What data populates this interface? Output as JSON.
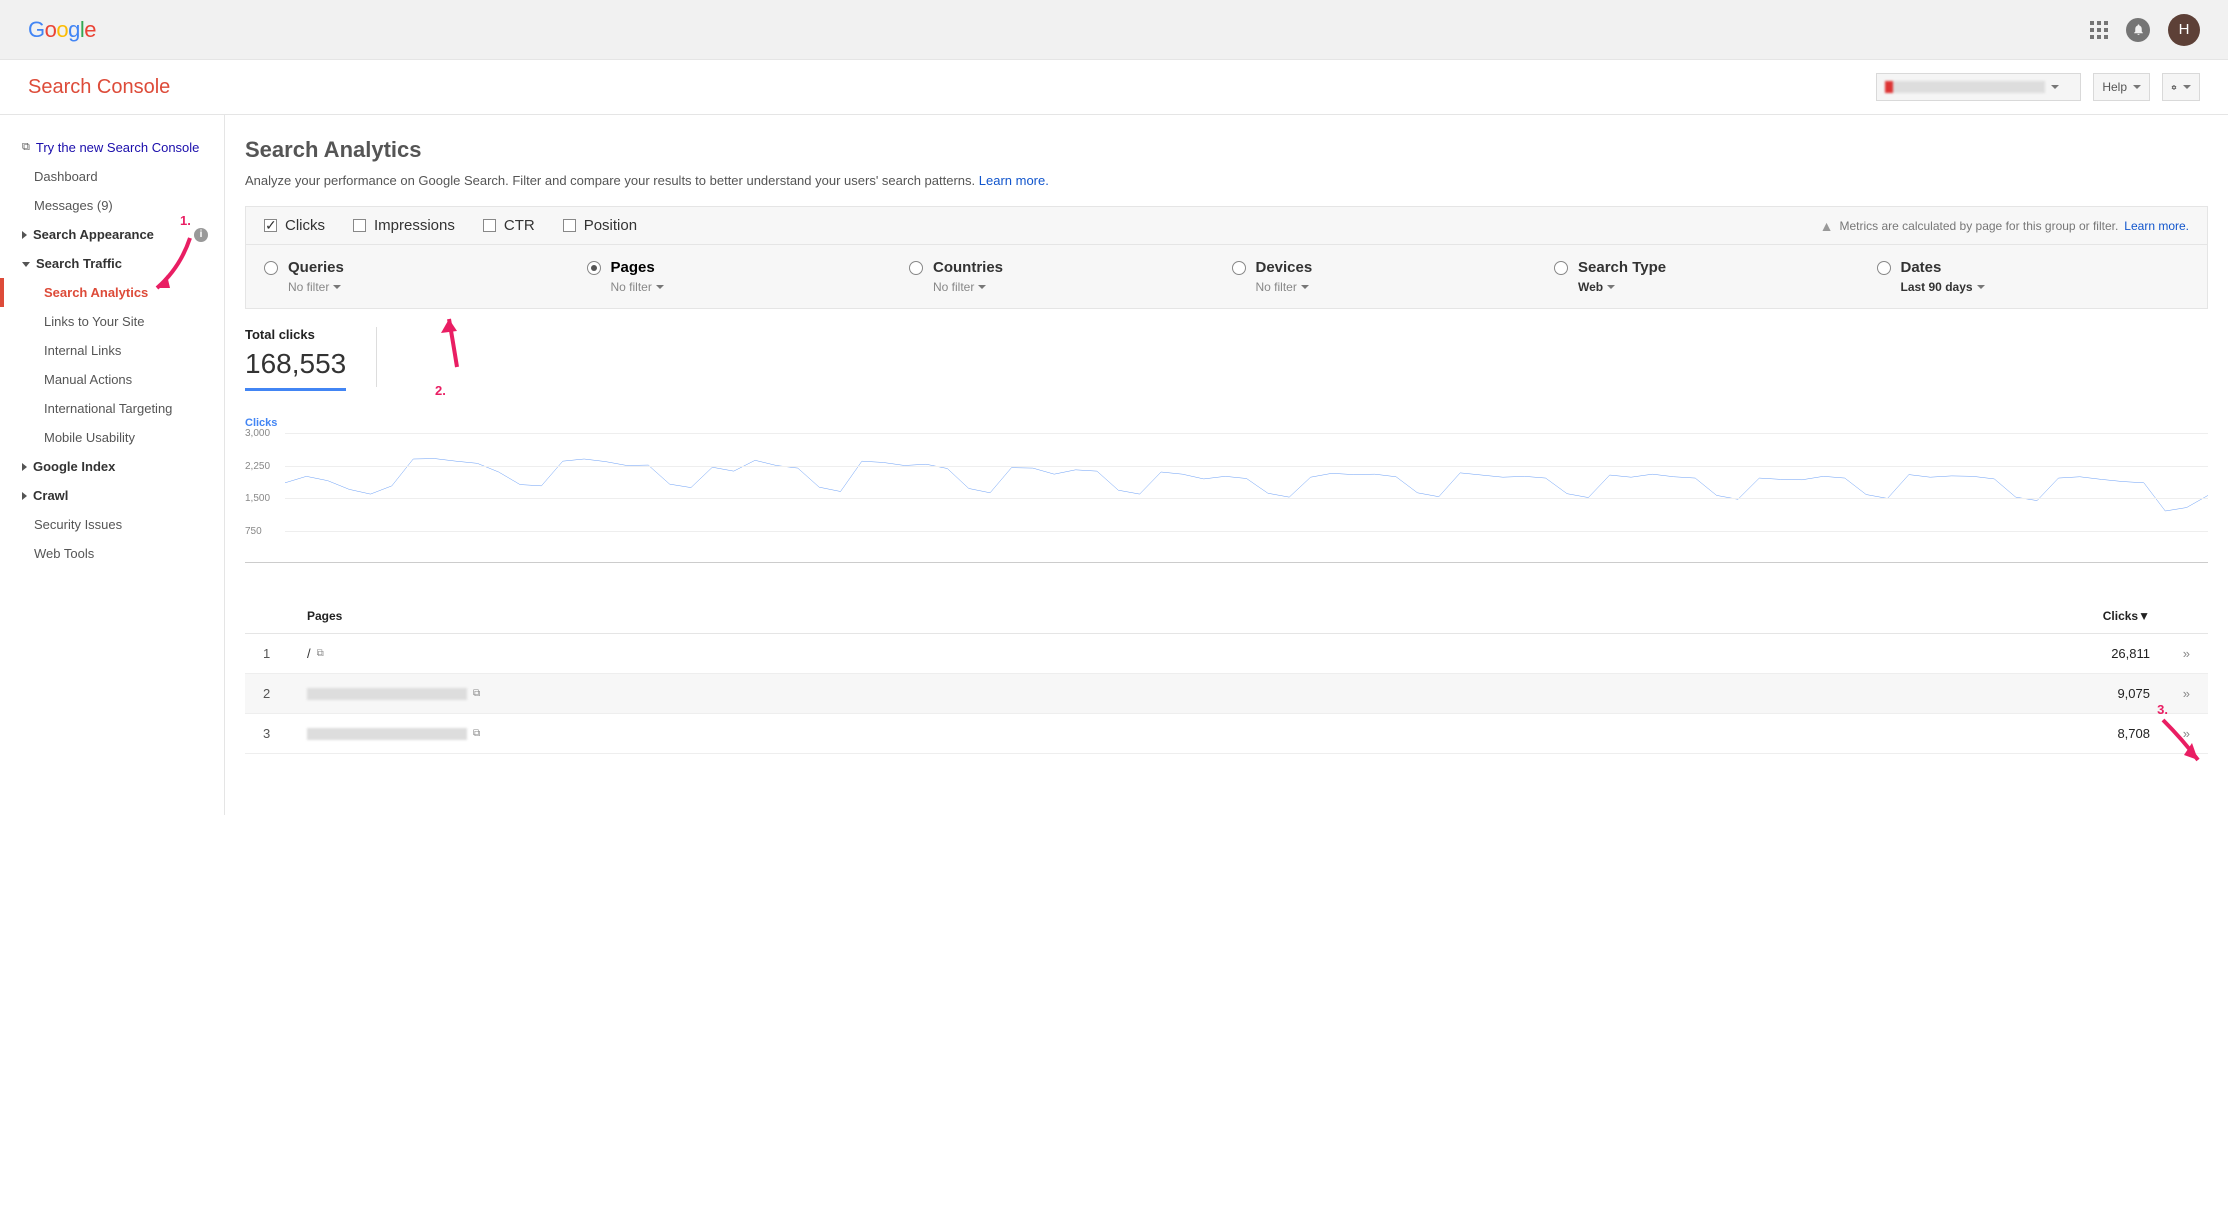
{
  "header": {
    "avatar_letter": "H",
    "site_selector": "(redacted)",
    "help_label": "Help",
    "search_console": "Search Console"
  },
  "sidebar": {
    "try_new": "Try the new Search Console",
    "dashboard": "Dashboard",
    "messages": "Messages (9)",
    "search_appearance": "Search Appearance",
    "search_traffic": "Search Traffic",
    "search_analytics": "Search Analytics",
    "links_to_site": "Links to Your Site",
    "internal_links": "Internal Links",
    "manual_actions": "Manual Actions",
    "intl_targeting": "International Targeting",
    "mobile_usability": "Mobile Usability",
    "google_index": "Google Index",
    "crawl": "Crawl",
    "security": "Security Issues",
    "web_tools": "Web Tools"
  },
  "page": {
    "title": "Search Analytics",
    "desc": "Analyze your performance on Google Search. Filter and compare your results to better understand your users' search patterns. ",
    "learn_more": "Learn more."
  },
  "metrics": {
    "clicks": "Clicks",
    "impressions": "Impressions",
    "ctr": "CTR",
    "position": "Position",
    "note": "Metrics are calculated by page for this group or filter. ",
    "note_link": "Learn more."
  },
  "dims": {
    "queries": "Queries",
    "pages": "Pages",
    "countries": "Countries",
    "devices": "Devices",
    "search_type": "Search Type",
    "dates": "Dates",
    "no_filter": "No filter",
    "web": "Web",
    "last90": "Last 90 days"
  },
  "totals": {
    "label": "Total clicks",
    "value": "168,553"
  },
  "chart_data": {
    "type": "line",
    "title": "Clicks",
    "xlabel": "",
    "ylabel": "",
    "ylim": [
      0,
      3000
    ],
    "yticks": [
      750,
      1500,
      2250,
      3000
    ],
    "series": [
      {
        "name": "Clicks",
        "color": "#4285F4",
        "values": [
          1850,
          2000,
          1900,
          1700,
          1590,
          1780,
          2400,
          2410,
          2350,
          2300,
          2100,
          1810,
          1780,
          2350,
          2400,
          2340,
          2250,
          2260,
          1820,
          1740,
          2210,
          2120,
          2370,
          2250,
          2190,
          1750,
          1650,
          2350,
          2320,
          2250,
          2280,
          2180,
          1720,
          1620,
          2200,
          2190,
          2050,
          2150,
          2120,
          1680,
          1590,
          2100,
          2050,
          1940,
          2000,
          1950,
          1610,
          1520,
          1980,
          2070,
          2040,
          2050,
          1990,
          1620,
          1530,
          2080,
          2030,
          1980,
          2000,
          1960,
          1600,
          1510,
          2030,
          1980,
          2050,
          1990,
          1960,
          1560,
          1470,
          1960,
          1930,
          1920,
          2000,
          1960,
          1580,
          1490,
          2040,
          1980,
          2010,
          2000,
          1940,
          1520,
          1440,
          1960,
          1990,
          1930,
          1880,
          1850,
          1200,
          1280,
          1560
        ]
      }
    ]
  },
  "table": {
    "col_pages": "Pages",
    "col_clicks": "Clicks",
    "sort_icon": "▼",
    "rows": [
      {
        "idx": "1",
        "page": "/",
        "clicks": "26,811"
      },
      {
        "idx": "2",
        "page": "(redacted)",
        "clicks": "9,075"
      },
      {
        "idx": "3",
        "page": "(redacted)",
        "clicks": "8,708"
      }
    ]
  },
  "annotations": {
    "a1": "1.",
    "a2": "2.",
    "a3": "3."
  }
}
